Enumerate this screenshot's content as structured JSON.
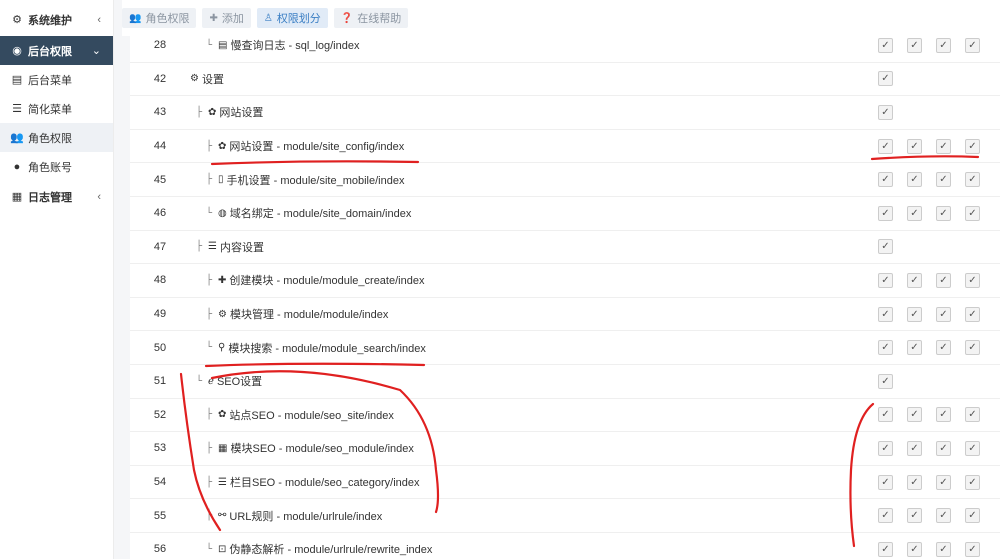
{
  "sidebar": {
    "items": [
      {
        "icon": "gear-icon",
        "glyph": "⚙",
        "label": "系统维护",
        "arrow": "‹",
        "variant": "group"
      },
      {
        "icon": "user-circle-icon",
        "glyph": "◉",
        "label": "后台权限",
        "arrow": "⌄",
        "variant": "active"
      },
      {
        "icon": "menu-icon",
        "glyph": "▤",
        "label": "后台菜单",
        "arrow": "",
        "variant": "sub"
      },
      {
        "icon": "list-icon",
        "glyph": "☰",
        "label": "简化菜单",
        "arrow": "",
        "variant": "sub"
      },
      {
        "icon": "users-icon",
        "glyph": "👥",
        "label": "角色权限",
        "arrow": "",
        "variant": "current"
      },
      {
        "icon": "user-icon",
        "glyph": "●",
        "label": "角色账号",
        "arrow": "",
        "variant": "sub"
      },
      {
        "icon": "calendar-icon",
        "glyph": "▦",
        "label": "日志管理",
        "arrow": "‹",
        "variant": "group"
      }
    ]
  },
  "toolbar": {
    "buttons": [
      {
        "icon": "users-icon",
        "glyph": "👥",
        "label": "角色权限",
        "primary": false
      },
      {
        "icon": "plus-icon",
        "glyph": "✚",
        "label": "添加",
        "primary": false
      },
      {
        "icon": "user-shield-icon",
        "glyph": "♙",
        "label": "权限划分",
        "primary": true
      },
      {
        "icon": "question-circle-icon",
        "glyph": "❓",
        "label": "在线帮助",
        "primary": false
      }
    ]
  },
  "rows": [
    {
      "id": "28",
      "indent": 2,
      "tree": "└",
      "icon": "database-icon",
      "glyph": "▤",
      "text": "慢查询日志 - sql_log/index",
      "checks": 4
    },
    {
      "id": "42",
      "indent": 0,
      "tree": "",
      "icon": "cogs-icon",
      "glyph": "⚙",
      "text": "设置",
      "checks": 1
    },
    {
      "id": "43",
      "indent": 1,
      "tree": "├",
      "icon": "gear-icon",
      "glyph": "✿",
      "text": "网站设置",
      "checks": 1
    },
    {
      "id": "44",
      "indent": 2,
      "tree": "├",
      "icon": "gear-icon",
      "glyph": "✿",
      "text": "网站设置 - module/site_config/index",
      "checks": 4
    },
    {
      "id": "45",
      "indent": 2,
      "tree": "├",
      "icon": "mobile-icon",
      "glyph": "▯",
      "text": "手机设置 - module/site_mobile/index",
      "checks": 4
    },
    {
      "id": "46",
      "indent": 2,
      "tree": "└",
      "icon": "globe-icon",
      "glyph": "◍",
      "text": "域名绑定 - module/site_domain/index",
      "checks": 4
    },
    {
      "id": "47",
      "indent": 1,
      "tree": "├",
      "icon": "list-icon",
      "glyph": "☰",
      "text": "内容设置",
      "checks": 1
    },
    {
      "id": "48",
      "indent": 2,
      "tree": "├",
      "icon": "plus-icon",
      "glyph": "✚",
      "text": "创建模块 - module/module_create/index",
      "checks": 4
    },
    {
      "id": "49",
      "indent": 2,
      "tree": "├",
      "icon": "cogs-icon",
      "glyph": "⚙",
      "text": "模块管理 - module/module/index",
      "checks": 4
    },
    {
      "id": "50",
      "indent": 2,
      "tree": "└",
      "icon": "search-icon",
      "glyph": "⚲",
      "text": "模块搜索 - module/module_search/index",
      "checks": 4
    },
    {
      "id": "51",
      "indent": 1,
      "tree": "└",
      "icon": "ie-icon",
      "glyph": "ℯ",
      "text": "SEO设置",
      "checks": 1
    },
    {
      "id": "52",
      "indent": 2,
      "tree": "├",
      "icon": "gear-icon",
      "glyph": "✿",
      "text": "站点SEO - module/seo_site/index",
      "checks": 4
    },
    {
      "id": "53",
      "indent": 2,
      "tree": "├",
      "icon": "grid-icon",
      "glyph": "▦",
      "text": "模块SEO - module/seo_module/index",
      "checks": 4
    },
    {
      "id": "54",
      "indent": 2,
      "tree": "├",
      "icon": "list-icon",
      "glyph": "☰",
      "text": "栏目SEO - module/seo_category/index",
      "checks": 4
    },
    {
      "id": "55",
      "indent": 2,
      "tree": "├",
      "icon": "link-icon",
      "glyph": "⚯",
      "text": "URL规则 - module/urlrule/index",
      "checks": 4
    },
    {
      "id": "56",
      "indent": 2,
      "tree": "└",
      "icon": "code-icon",
      "glyph": "⊡",
      "text": "伪静态解析 - module/urlrule/rewrite_index",
      "checks": 4
    }
  ],
  "colors": {
    "accent": "#3b7fc4",
    "sidebar_active": "#344a5f",
    "annotation": "#e02020"
  }
}
